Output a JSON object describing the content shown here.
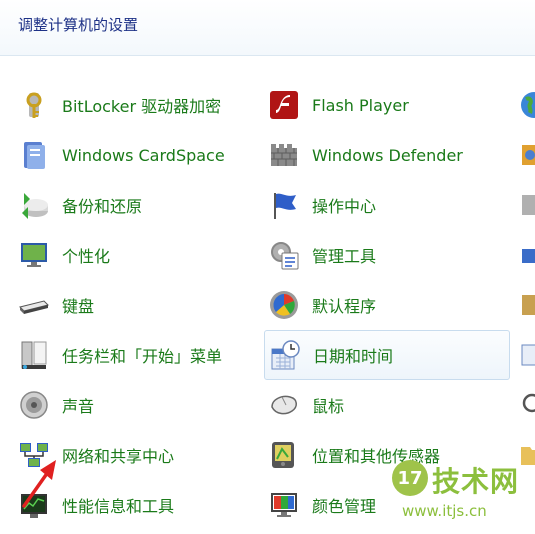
{
  "header": {
    "title": "调整计算机的设置"
  },
  "items": [
    {
      "label": "BitLocker 驱动器加密",
      "icon": "bitlocker-key-icon"
    },
    {
      "label": "Flash Player",
      "icon": "flash-player-icon"
    },
    {
      "label": "Windows CardSpace",
      "icon": "cardspace-icon"
    },
    {
      "label": "Windows Defender",
      "icon": "windows-defender-icon"
    },
    {
      "label": "备份和还原",
      "icon": "backup-restore-icon"
    },
    {
      "label": "操作中心",
      "icon": "action-center-flag-icon"
    },
    {
      "label": "个性化",
      "icon": "personalization-icon"
    },
    {
      "label": "管理工具",
      "icon": "admin-tools-icon"
    },
    {
      "label": "键盘",
      "icon": "keyboard-icon"
    },
    {
      "label": "默认程序",
      "icon": "default-programs-icon"
    },
    {
      "label": "任务栏和「开始」菜单",
      "icon": "taskbar-start-menu-icon"
    },
    {
      "label": "日期和时间",
      "icon": "date-time-icon"
    },
    {
      "label": "声音",
      "icon": "sound-speaker-icon"
    },
    {
      "label": "鼠标",
      "icon": "mouse-icon"
    },
    {
      "label": "网络和共享中心",
      "icon": "network-sharing-icon"
    },
    {
      "label": "位置和其他传感器",
      "icon": "location-sensors-icon"
    },
    {
      "label": "性能信息和工具",
      "icon": "performance-icon"
    },
    {
      "label": "颜色管理",
      "icon": "color-management-icon"
    }
  ],
  "watermark": {
    "name": "技术网",
    "logo_text": "17",
    "url": "www.itjs.cn"
  },
  "colors": {
    "link": "#1a7a19",
    "title": "#1e3287",
    "selected_border": "#c8dcee",
    "arrow": "#e02020"
  }
}
